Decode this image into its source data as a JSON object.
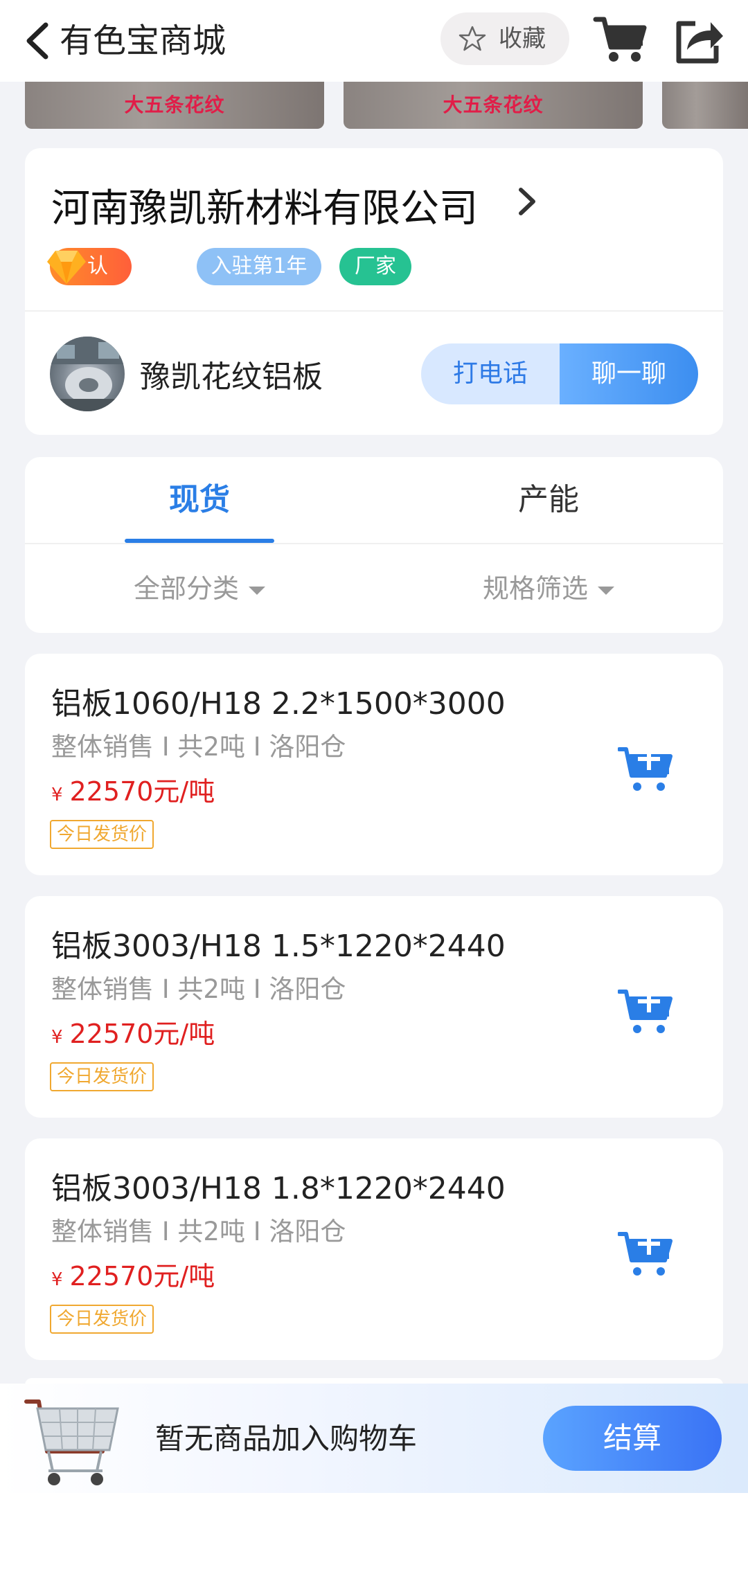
{
  "header": {
    "title": "有色宝商城",
    "favorite_label": "收藏"
  },
  "banner": {
    "thumbnail_captions": [
      "大五条花纹",
      "大五条花纹",
      ""
    ]
  },
  "company": {
    "name": "河南豫凯新材料有限公司",
    "badges": {
      "certified": "认证",
      "years": "入驻第1年",
      "type": "厂家"
    },
    "shop_name": "豫凯花纹铝板",
    "call_label": "打电话",
    "chat_label": "聊一聊"
  },
  "tabs": {
    "items": [
      {
        "label": "现货",
        "active": true
      },
      {
        "label": "产能",
        "active": false
      }
    ],
    "filters": {
      "category": "全部分类",
      "spec": "规格筛选"
    }
  },
  "products": [
    {
      "name": "铝板1060/H18 2.2*1500*3000",
      "meta": "整体销售 I 共2吨 I 洛阳仓",
      "currency": "¥",
      "price": "22570元/吨",
      "tag": "今日发货价"
    },
    {
      "name": "铝板3003/H18 1.5*1220*2440",
      "meta": "整体销售 I 共2吨 I 洛阳仓",
      "currency": "¥",
      "price": "22570元/吨",
      "tag": "今日发货价"
    },
    {
      "name": "铝板3003/H18 1.8*1220*2440",
      "meta": "整体销售 I 共2吨 I 洛阳仓",
      "currency": "¥",
      "price": "22570元/吨",
      "tag": "今日发货价"
    }
  ],
  "cart_bar": {
    "message": "暂无商品加入购物车",
    "checkout_label": "结算"
  },
  "colors": {
    "accent": "#2a7ee6",
    "price": "#e02020",
    "tag": "#f0a830",
    "background": "#f2f3f7"
  }
}
